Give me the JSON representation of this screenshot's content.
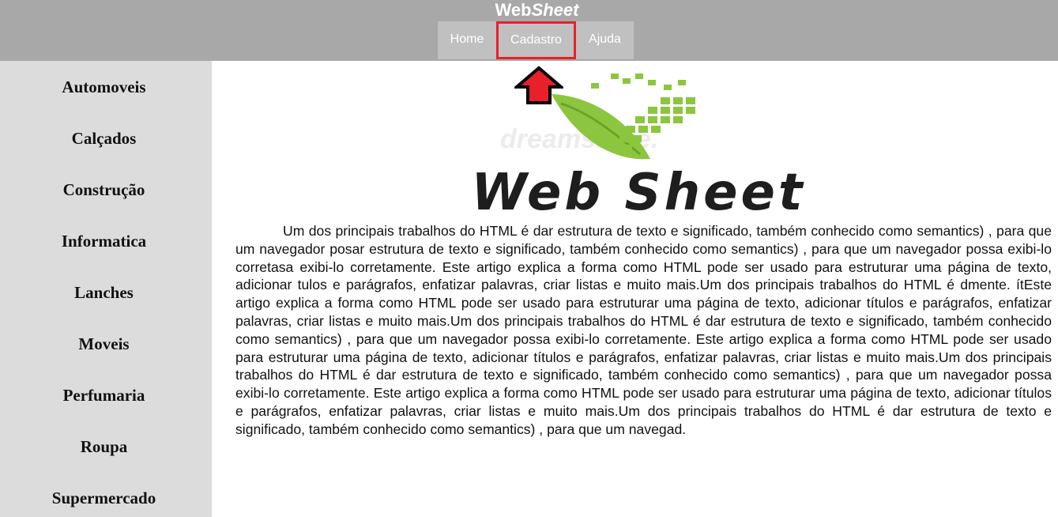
{
  "header": {
    "brand_part1": "Web",
    "brand_part2": "Sheet",
    "nav": {
      "home": "Home",
      "cadastro": "Cadastro",
      "ajuda": "Ajuda"
    },
    "highlight_color": "#e8202a"
  },
  "sidebar": {
    "items": [
      {
        "label": "Automoveis"
      },
      {
        "label": "Calçados"
      },
      {
        "label": "Construção"
      },
      {
        "label": "Informatica"
      },
      {
        "label": "Lanches"
      },
      {
        "label": "Moveis"
      },
      {
        "label": "Perfumaria"
      },
      {
        "label": "Roupa"
      },
      {
        "label": "Supermercado"
      }
    ]
  },
  "logo": {
    "title_text": "Web Sheet",
    "watermark_text": "dreamstime.",
    "icon": "green-leaf-pixel-icon"
  },
  "arrow": {
    "icon": "arrow-up-icon",
    "color": "#e8202a"
  },
  "main": {
    "paragraph": "Um dos principais trabalhos do HTML é dar estrutura de texto e significado, também conhecido como semantics) , para que um navegador posar estrutura de texto e significado, também conhecido como semantics) , para que um navegador possa exibi-lo corretasa exibi-lo corretamente. Este artigo explica a forma como HTML pode ser usado para estruturar uma página de texto, adicionar tulos e parágrafos, enfatizar palavras, criar listas e muito mais.Um dos principais trabalhos do HTML é dmente. ítEste artigo explica a forma como HTML pode ser usado para estruturar uma página de texto, adicionar títulos e parágrafos, enfatizar palavras, criar listas e muito mais.Um dos principais trabalhos do HTML é dar estrutura de texto e significado, também conhecido como semantics) , para que um navegador possa exibi-lo corretamente. Este artigo explica a forma como HTML pode ser usado para estruturar uma página de texto, adicionar títulos e parágrafos, enfatizar palavras, criar listas e muito mais.Um dos principais trabalhos do HTML é dar estrutura de texto e significado, também conhecido como semantics) , para que um navegador possa exibi-lo corretamente. Este artigo explica a forma como HTML pode ser usado para estruturar uma página de texto, adicionar títulos e parágrafos, enfatizar palavras, criar listas e muito mais.Um dos principais trabalhos do HTML é dar estrutura de texto e significado, também conhecido como semantics) , para que um navegad."
  }
}
